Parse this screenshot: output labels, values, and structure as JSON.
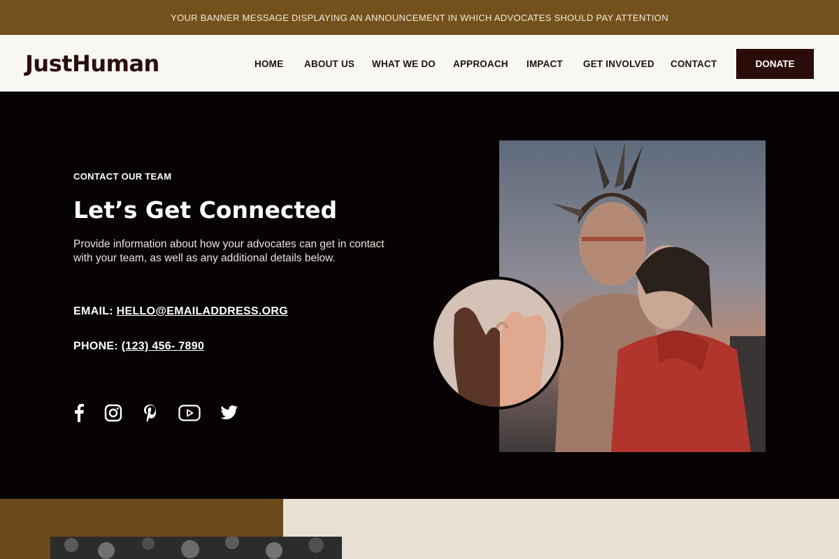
{
  "banner": {
    "text": "YOUR BANNER MESSAGE DISPLAYING AN ANNOUNCEMENT IN WHICH ADVOCATES SHOULD PAY ATTENTION"
  },
  "header": {
    "logo": "JustHuman",
    "nav": [
      "HOME",
      "ABOUT US",
      "WHAT WE DO",
      "APPROACH",
      "IMPACT",
      "GET INVOLVED",
      "CONTACT"
    ],
    "donate_label": "DONATE"
  },
  "hero": {
    "eyebrow": "CONTACT OUR TEAM",
    "title": "Let’s Get Connected",
    "description": "Provide information about how your advocates can get in contact with your team, as well as any additional details below.",
    "email_label": "EMAIL:",
    "email_value": "HELLO@EMAILADDRESS.ORG",
    "phone_label": "PHONE:",
    "phone_value": "(123) 456- 7890",
    "social_icons": [
      "facebook-icon",
      "instagram-icon",
      "pinterest-icon",
      "youtube-icon",
      "twitter-icon"
    ]
  },
  "colors": {
    "banner_bg": "#74511c",
    "header_bg": "#f8f7f3",
    "hero_bg": "#070203",
    "donate_bg": "#2b0c08",
    "section_brown": "#6a4b19",
    "section_cream": "#e8e0d5"
  }
}
